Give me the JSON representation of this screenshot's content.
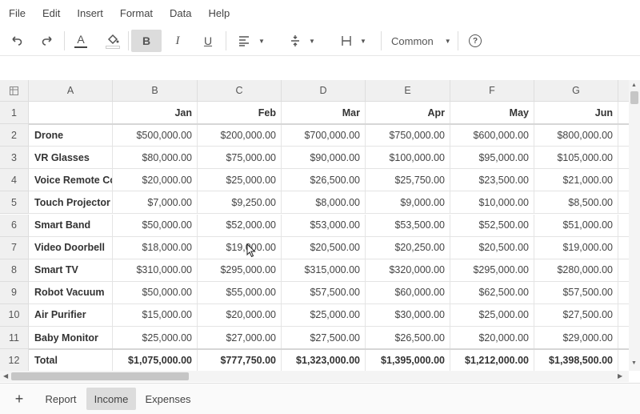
{
  "menu": [
    "File",
    "Edit",
    "Insert",
    "Format",
    "Data",
    "Help"
  ],
  "toolbar": {
    "undo": "undo-icon",
    "redo": "redo-icon",
    "text_color": "A",
    "bold": "B",
    "italic": "I",
    "underline": "U",
    "number_format": "Common",
    "help": "?"
  },
  "formula_bar": {
    "value": ""
  },
  "columns": [
    "A",
    "B",
    "C",
    "D",
    "E",
    "F",
    "G"
  ],
  "rows": [
    {
      "n": "1",
      "label": "",
      "values": [
        "Jan",
        "Feb",
        "Mar",
        "Apr",
        "May",
        "Jun"
      ]
    },
    {
      "n": "2",
      "label": "Drone",
      "values": [
        "$500,000.00",
        "$200,000.00",
        "$700,000.00",
        "$750,000.00",
        "$600,000.00",
        "$800,000.00"
      ]
    },
    {
      "n": "3",
      "label": "VR Glasses",
      "values": [
        "$80,000.00",
        "$75,000.00",
        "$90,000.00",
        "$100,000.00",
        "$95,000.00",
        "$105,000.00"
      ]
    },
    {
      "n": "4",
      "label": "Voice Remote Col",
      "values": [
        "$20,000.00",
        "$25,000.00",
        "$26,500.00",
        "$25,750.00",
        "$23,500.00",
        "$21,000.00"
      ]
    },
    {
      "n": "5",
      "label": "Touch Projector",
      "values": [
        "$7,000.00",
        "$9,250.00",
        "$8,000.00",
        "$9,000.00",
        "$10,000.00",
        "$8,500.00"
      ]
    },
    {
      "n": "6",
      "label": "Smart Band",
      "values": [
        "$50,000.00",
        "$52,000.00",
        "$53,000.00",
        "$53,500.00",
        "$52,500.00",
        "$51,000.00"
      ]
    },
    {
      "n": "7",
      "label": "Video Doorbell",
      "values": [
        "$18,000.00",
        "$19,000.00",
        "$20,500.00",
        "$20,250.00",
        "$20,500.00",
        "$19,000.00"
      ]
    },
    {
      "n": "8",
      "label": "Smart TV",
      "values": [
        "$310,000.00",
        "$295,000.00",
        "$315,000.00",
        "$320,000.00",
        "$295,000.00",
        "$280,000.00"
      ]
    },
    {
      "n": "9",
      "label": "Robot Vacuum",
      "values": [
        "$50,000.00",
        "$55,000.00",
        "$57,500.00",
        "$60,000.00",
        "$62,500.00",
        "$57,500.00"
      ]
    },
    {
      "n": "10",
      "label": "Air Purifier",
      "values": [
        "$15,000.00",
        "$20,000.00",
        "$25,000.00",
        "$30,000.00",
        "$25,000.00",
        "$27,500.00"
      ]
    },
    {
      "n": "11",
      "label": "Baby Monitor",
      "values": [
        "$25,000.00",
        "$27,000.00",
        "$27,500.00",
        "$26,500.00",
        "$20,000.00",
        "$29,000.00"
      ]
    },
    {
      "n": "12",
      "label": "Total",
      "values": [
        "$1,075,000.00",
        "$777,750.00",
        "$1,323,000.00",
        "$1,395,000.00",
        "$1,212,000.00",
        "$1,398,500.00"
      ]
    }
  ],
  "sheets": {
    "add": "+",
    "tabs": [
      "Report",
      "Income",
      "Expenses"
    ],
    "active": "Income"
  }
}
